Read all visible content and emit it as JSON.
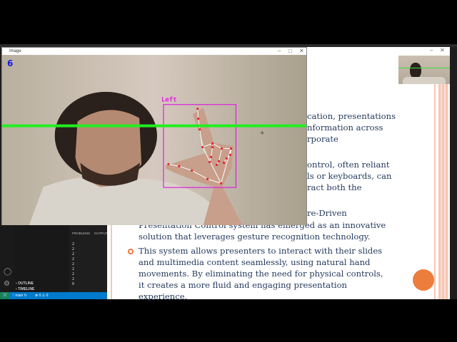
{
  "image_window": {
    "title": "Image",
    "finger_count": "6",
    "hand_label": "Left"
  },
  "slide": {
    "fragments": [
      "cation, presentations",
      "nformation across",
      "rporate",
      "ontrol, often reliant",
      "ls or keyboards, can",
      "ract both the",
      "re-Driven"
    ],
    "para1_lines": [
      "Presentation Control system has emerged as an innovative",
      "solution that leverages gesture recognition technology."
    ],
    "bullet2_lines": [
      "This system allows presenters to interact with their slides",
      "and multimedia content seamlessly, using natural hand",
      "movements. By eliminating the need for physical controls,",
      "it creates a more fluid and engaging presentation",
      "experience."
    ],
    "accent_color": "#ec7d3c"
  },
  "vscode": {
    "sections": [
      "OUTLINE",
      "TIMELINE"
    ],
    "panel_tabs": [
      "PROBLEMS",
      "OUTPUT"
    ],
    "terminal_lines": [
      "2",
      "2",
      "2",
      "2",
      "2",
      "2",
      "2",
      "2",
      "0"
    ],
    "status": {
      "branch": "main",
      "errors": "0",
      "warnings": "0"
    }
  },
  "window_controls": {
    "minimize": "–",
    "maximize": "□",
    "close": "✕"
  }
}
